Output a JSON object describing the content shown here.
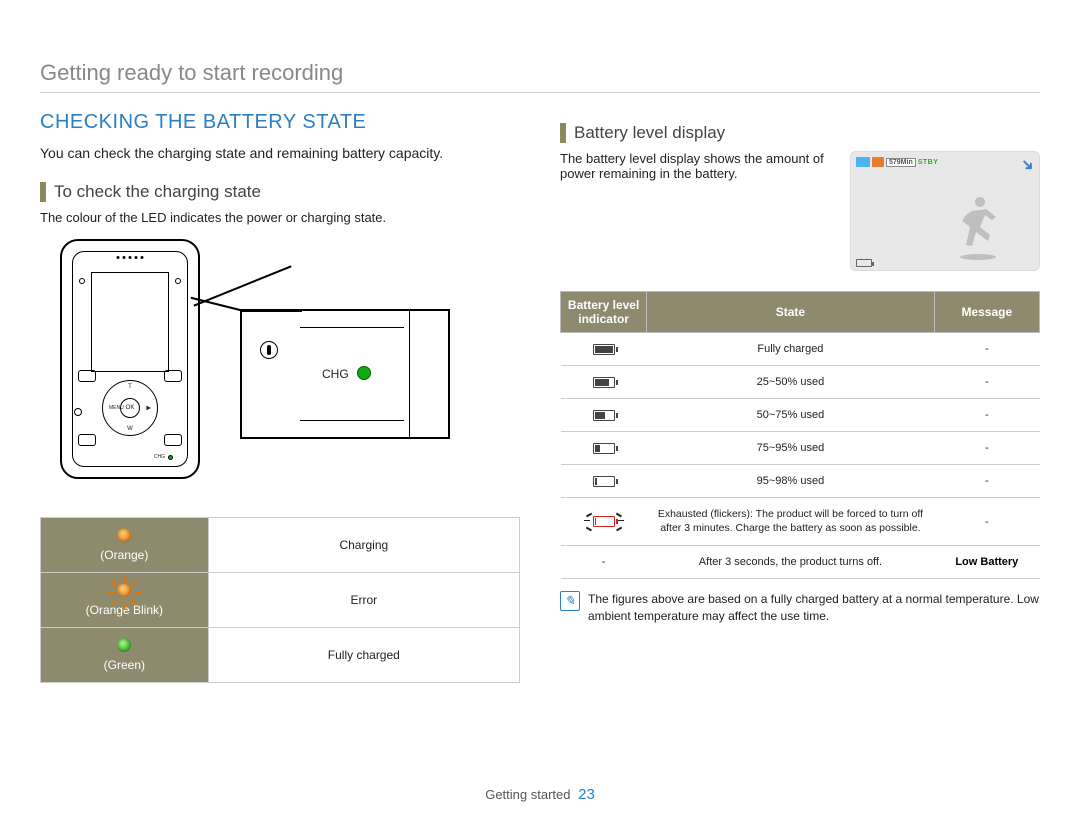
{
  "chapter": "Getting ready to start recording",
  "main_heading": "CHECKING THE BATTERY STATE",
  "intro_text": "You can check the charging state and remaining battery capacity.",
  "sub1_heading": "To check the charging state",
  "sub1_text": "The colour of the LED indicates the power or charging state.",
  "sub2_heading": "Battery level display",
  "sub2_text": "The battery level display shows the amount of power remaining in the battery.",
  "device": {
    "chg_label": "CHG",
    "ok_label": "OK",
    "labels": {
      "t": "T",
      "w": "W",
      "menu": "MENU"
    }
  },
  "led_table": [
    {
      "color": "orange",
      "label": "(Orange)",
      "state": "Charging"
    },
    {
      "color": "orange-blink",
      "label": "(Orange Blink)",
      "state": "Error"
    },
    {
      "color": "green",
      "label": "(Green)",
      "state": "Fully charged"
    }
  ],
  "thumb": {
    "time_remaining": "579Min",
    "status": "STBY"
  },
  "batt_headers": {
    "indicator": "Battery level indicator",
    "state": "State",
    "message": "Message"
  },
  "batt_rows": [
    {
      "level": 4,
      "state": "Fully charged",
      "message": "-"
    },
    {
      "level": 3,
      "state": "25~50% used",
      "message": "-"
    },
    {
      "level": 2,
      "state": "50~75% used",
      "message": "-"
    },
    {
      "level": 1,
      "state": "75~95% used",
      "message": "-"
    },
    {
      "level": 0,
      "state": "95~98% used",
      "message": "-"
    },
    {
      "level": "red",
      "state": "Exhausted (flickers): The product will be forced to turn off after 3 minutes. Charge the battery as soon as possible.",
      "message": "-"
    },
    {
      "level": "none",
      "state": "After 3 seconds, the product turns off.",
      "message": "Low Battery"
    }
  ],
  "note_text": "The figures above are based on a fully charged battery at a normal temperature. Low ambient temperature may affect the use time.",
  "footer": {
    "section": "Getting started",
    "page": "23"
  }
}
